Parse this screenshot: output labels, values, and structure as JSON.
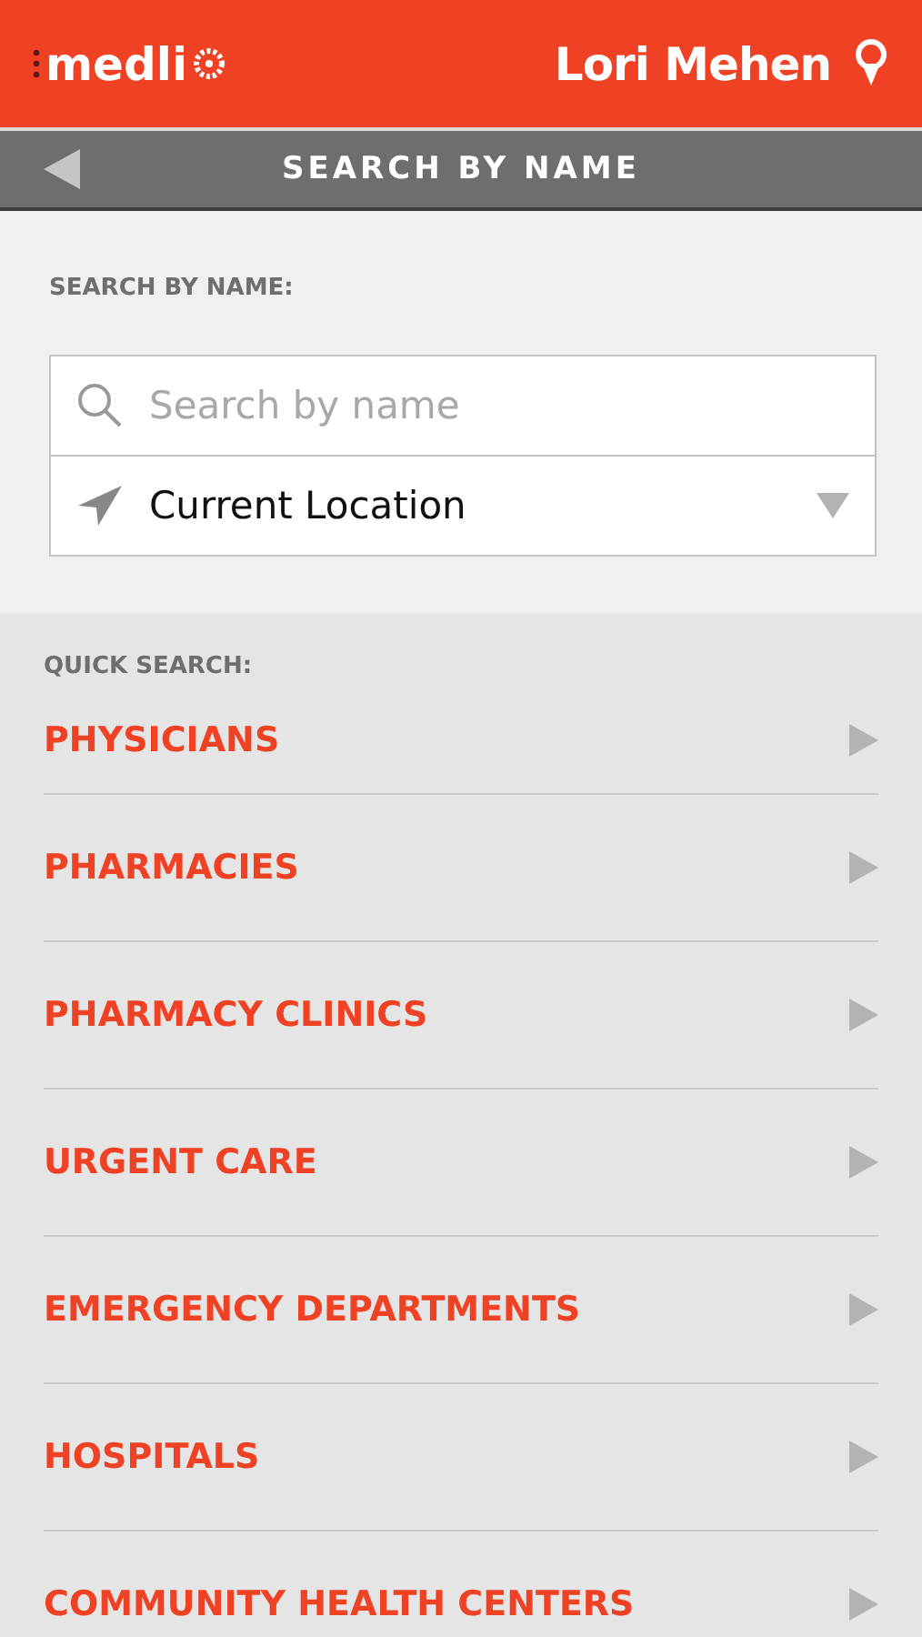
{
  "header": {
    "logo": "medli",
    "user_name": "Lori Mehen"
  },
  "nav_bar": {
    "title": "SEARCH BY NAME"
  },
  "search": {
    "label": "SEARCH BY NAME:",
    "placeholder": "Search by name",
    "location": "Current Location"
  },
  "quick_search": {
    "label": "QUICK SEARCH:",
    "items": [
      {
        "label": "PHYSICIANS"
      },
      {
        "label": "PHARMACIES"
      },
      {
        "label": "PHARMACY CLINICS"
      },
      {
        "label": "URGENT CARE"
      },
      {
        "label": "EMERGENCY DEPARTMENTS"
      },
      {
        "label": "HOSPITALS"
      },
      {
        "label": "COMMUNITY HEALTH CENTERS"
      }
    ]
  }
}
